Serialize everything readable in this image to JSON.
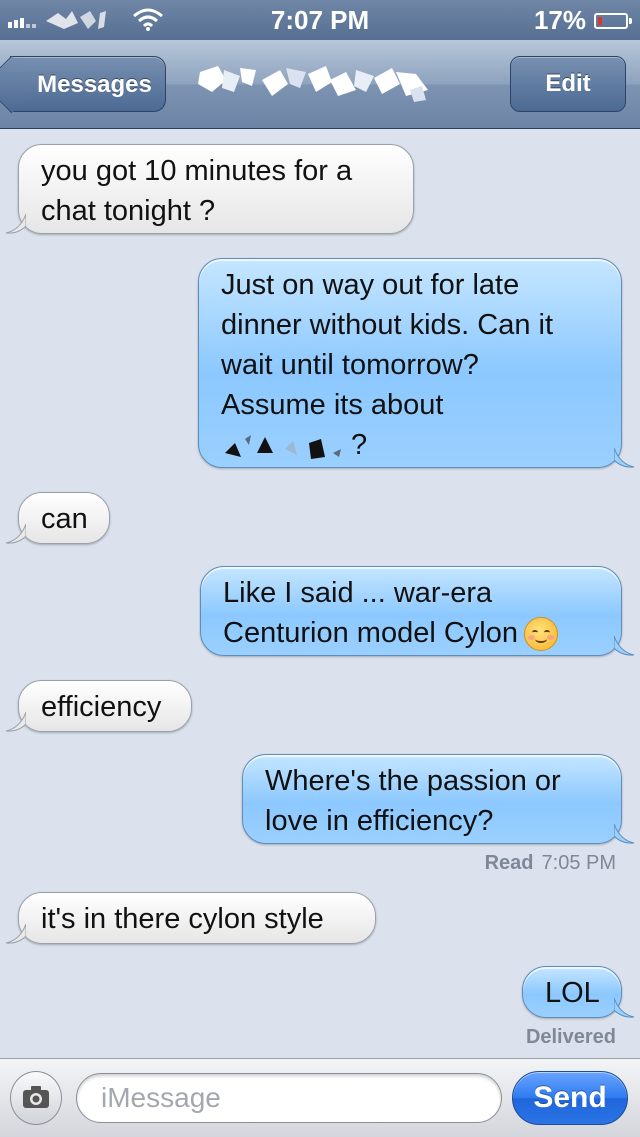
{
  "status_bar": {
    "time": "7:07 PM",
    "battery": "17%",
    "battery_level": 0.17,
    "icons": [
      "signal-bars-icon",
      "wifi-icon",
      "battery-icon"
    ]
  },
  "nav": {
    "back_label": "Messages",
    "edit_label": "Edit",
    "contact_name_redacted": true
  },
  "messages": [
    {
      "direction": "incoming",
      "text": "you got 10 minutes for a\nchat tonight ?"
    },
    {
      "direction": "outgoing",
      "text": "Just on way out for late\ndinner without kids. Can it\nwait until tomorrow?\nAssume its about",
      "suffix": "?"
    },
    {
      "direction": "incoming",
      "text": "can"
    },
    {
      "direction": "outgoing",
      "text": "Like I said ... war-era\nCenturion model Cylon",
      "emoji": "smiling-face-icon"
    },
    {
      "direction": "incoming",
      "text": "efficiency"
    },
    {
      "direction": "outgoing",
      "text": "Where's the passion or\nlove in efficiency?"
    },
    {
      "direction": "incoming",
      "text": "it's in there cylon style"
    },
    {
      "direction": "outgoing",
      "text": "LOL"
    }
  ],
  "receipts": {
    "read_label": "Read",
    "read_time": "7:05 PM",
    "delivered_label": "Delivered"
  },
  "input_bar": {
    "placeholder": "iMessage",
    "value": "",
    "send_label": "Send"
  },
  "colors": {
    "background": "#dbe2ed",
    "outgoing_bubble": "#8cc8ff",
    "incoming_bubble": "#ffffff",
    "send_button": "#2e7cf0"
  }
}
